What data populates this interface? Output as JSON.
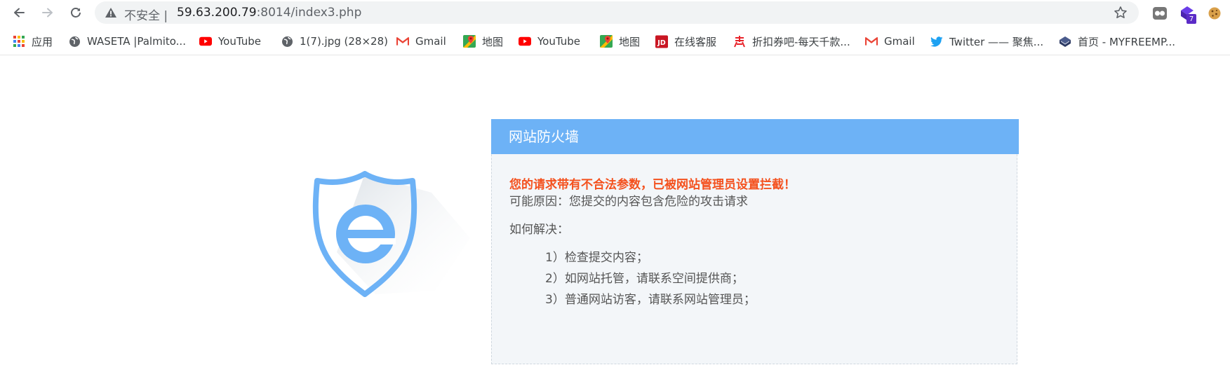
{
  "browser": {
    "security_label": "不安全",
    "separator": "|",
    "url_host": "59.63.200.79",
    "url_path": ":8014/index3.php",
    "extension_badge": "7"
  },
  "bookmarks": [
    {
      "label": "应用",
      "icon": "apps-grid-icon"
    },
    {
      "label": "WASETA |Palmito...",
      "icon": "globe-icon"
    },
    {
      "label": "YouTube",
      "icon": "youtube-icon"
    },
    {
      "label": "1(7).jpg (28×28)",
      "icon": "globe-icon"
    },
    {
      "label": "Gmail",
      "icon": "gmail-icon"
    },
    {
      "label": "地图",
      "icon": "maps-icon"
    },
    {
      "label": "YouTube",
      "icon": "youtube-icon"
    },
    {
      "label": "地图",
      "icon": "maps-icon"
    },
    {
      "label": "在线客服",
      "icon": "jd-icon"
    },
    {
      "label": "折扣券吧-每天千款...",
      "icon": "coupon-icon"
    },
    {
      "label": "Gmail",
      "icon": "gmail-icon"
    },
    {
      "label": "Twitter —— 聚焦...",
      "icon": "twitter-icon"
    },
    {
      "label": "首页 - MYFREEMP...",
      "icon": "book-icon"
    }
  ],
  "firewall": {
    "title": "网站防火墙",
    "warning": "您的请求带有不合法参数，已被网站管理员设置拦截！",
    "reason": "可能原因：您提交的内容包含危险的攻击请求",
    "howto": "如何解决：",
    "steps": [
      "1）检查提交内容；",
      "2）如网站托管，请联系空间提供商；",
      "3）普通网站访客，请联系网站管理员；"
    ]
  },
  "colors": {
    "header": "#6db2f6",
    "warning": "#f4511e",
    "shield": "#6db2f6",
    "panel_bg": "#f3f6f9"
  }
}
